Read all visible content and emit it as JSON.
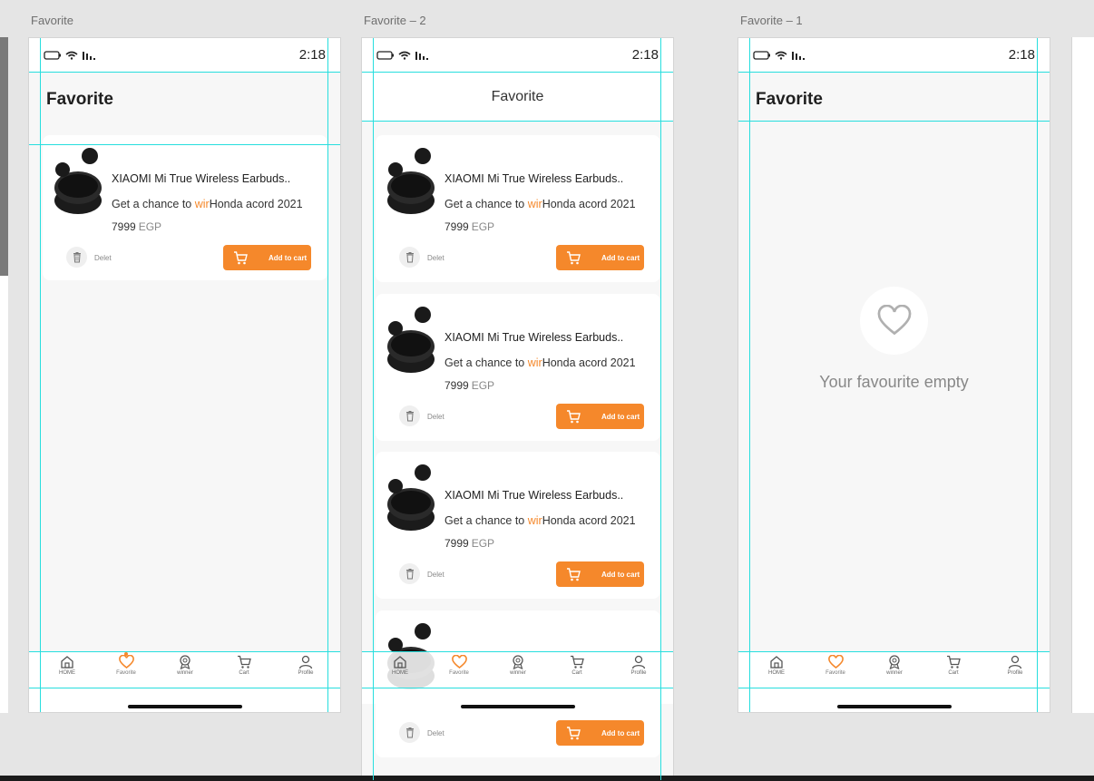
{
  "artboards": [
    {
      "title": "Favorite",
      "time": "2:18",
      "header": "Favorite",
      "cards": [
        {
          "name": "XIAOMI Mi True Wireless Earbuds..",
          "chance_prefix": "Get a chance to ",
          "chance_highlight": "wir",
          "chance_suffix": "Honda acord 2021",
          "price": "7999",
          "currency": "EGP",
          "delete_label": "Delet",
          "add_label": "Add to cart"
        }
      ]
    },
    {
      "title": "Favorite – 2",
      "time": "2:18",
      "header": "Favorite",
      "cards": [
        {
          "name": "XIAOMI Mi True Wireless Earbuds..",
          "chance_prefix": "Get a chance to ",
          "chance_highlight": "wir",
          "chance_suffix": "Honda acord 2021",
          "price": "7999",
          "currency": "EGP",
          "delete_label": "Delet",
          "add_label": "Add to cart"
        },
        {
          "name": "XIAOMI Mi True Wireless Earbuds..",
          "chance_prefix": "Get a chance to ",
          "chance_highlight": "wir",
          "chance_suffix": "Honda acord 2021",
          "price": "7999",
          "currency": "EGP",
          "delete_label": "Delet",
          "add_label": "Add to cart"
        },
        {
          "name": "XIAOMI Mi True Wireless Earbuds..",
          "chance_prefix": "Get a chance to ",
          "chance_highlight": "wir",
          "chance_suffix": "Honda acord 2021",
          "price": "7999",
          "currency": "EGP",
          "delete_label": "Delet",
          "add_label": "Add to cart"
        },
        {
          "name": "",
          "delete_label": "Delet",
          "add_label": "Add to cart"
        }
      ]
    },
    {
      "title": "Favorite – 1",
      "time": "2:18",
      "header": "Favorite",
      "empty_text": "Your favourite empty"
    }
  ],
  "tabs": [
    {
      "label": "HOME",
      "icon": "home-icon"
    },
    {
      "label": "Favorite",
      "icon": "heart-icon"
    },
    {
      "label": "winner",
      "icon": "award-icon"
    },
    {
      "label": "Cart",
      "icon": "cart-icon"
    },
    {
      "label": "Profile",
      "icon": "user-icon"
    }
  ],
  "colors": {
    "accent": "#f5882b",
    "guide": "#27dede",
    "canvas": "#e5e5e5"
  }
}
